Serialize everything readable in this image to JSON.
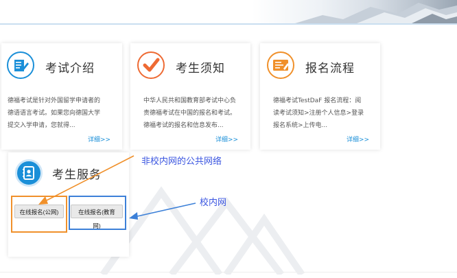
{
  "cards": [
    {
      "title": "考试介绍",
      "icon": "document-pen-icon",
      "desc": [
        "德福考试是针对外国留学申请者的",
        "德语语言考试。如果您向德国大学",
        "提交入学申请，您就得..."
      ],
      "link": "详细>>"
    },
    {
      "title": "考生须知",
      "icon": "checkmark-icon",
      "desc": [
        "中华人民共和国教育部考试中心负",
        "责德福考试在中国的报名和考试。",
        "德福考试的报名和信息发布..."
      ],
      "link": "详细>>"
    },
    {
      "title": "报名流程",
      "icon": "form-card-icon",
      "desc": [
        "德福考试TestDaF 报名流程：阅",
        "读考试须知>注册个人信息>登录",
        "报名系统>上传电..."
      ],
      "link": "详细>>"
    }
  ],
  "service": {
    "title": "考生服务",
    "icon": "contact-book-icon",
    "btn_public": "在线报名(公网)",
    "btn_edu": "在线报名(教育网)"
  },
  "annotations": {
    "public_note": "非校内网的公共网络",
    "campus_note": "校内网"
  },
  "colors": {
    "blue_accent": "#1a8fd8",
    "orange_accent": "#ee6a33",
    "annotation_orange": "#f0902a",
    "annotation_blue": "#3c80d8"
  }
}
